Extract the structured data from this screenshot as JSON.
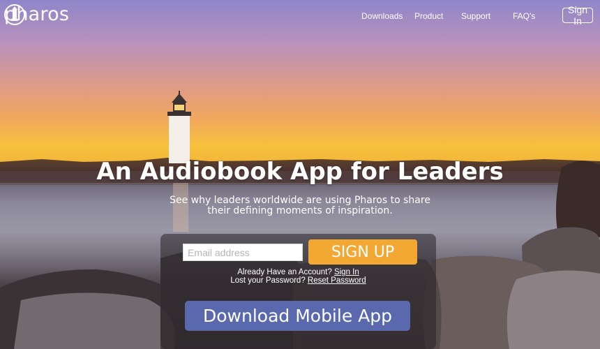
{
  "brand": {
    "name": "pharos",
    "logo_icon": "lighthouse-logo-icon"
  },
  "nav": {
    "items": [
      "Downloads",
      "Product",
      "Support",
      "FAQ's"
    ],
    "signin_label": "Sign In"
  },
  "hero": {
    "headline": "An Audiobook App for Leaders",
    "subline_1": "See why leaders worldwide are using Pharos to share",
    "subline_2": "their defining moments of inspiration."
  },
  "form": {
    "email_placeholder": "Email address",
    "email_value": "",
    "signup_label": "SIGN UP",
    "account_prompt": "Already Have an Account?",
    "account_link": "Sign In",
    "password_prompt": "Lost your Password?",
    "password_link": "Reset Password"
  },
  "download": {
    "label": "Download Mobile App"
  },
  "colors": {
    "accent_orange": "#f3a833",
    "accent_blue": "#5a69ae"
  }
}
